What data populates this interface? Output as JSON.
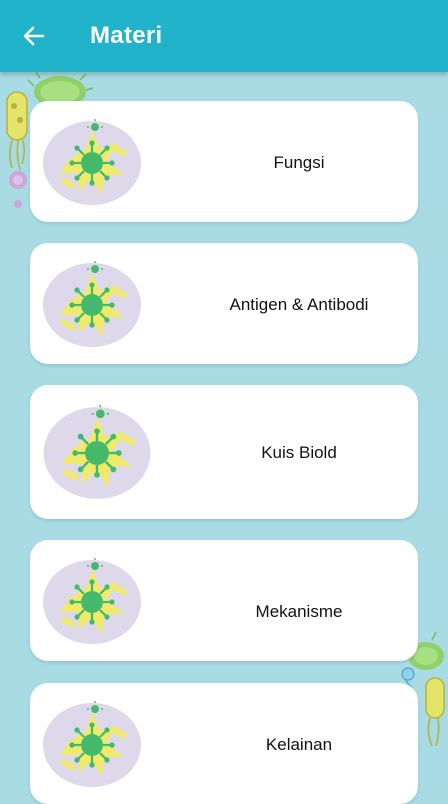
{
  "appbar": {
    "title": "Materi",
    "back_icon": "arrow-left-icon",
    "color": "#20b3c9"
  },
  "background_color": "#a8dbe4",
  "menu": {
    "items": [
      {
        "label": "Fungsi",
        "icon": "virus-illustration-icon"
      },
      {
        "label": "Antigen & Antibodi",
        "icon": "virus-illustration-icon"
      },
      {
        "label": "Kuis Biold",
        "icon": "virus-illustration-icon"
      },
      {
        "label": "Mekanisme",
        "icon": "virus-illustration-icon"
      },
      {
        "label": "Kelainan",
        "icon": "virus-illustration-icon"
      }
    ]
  }
}
